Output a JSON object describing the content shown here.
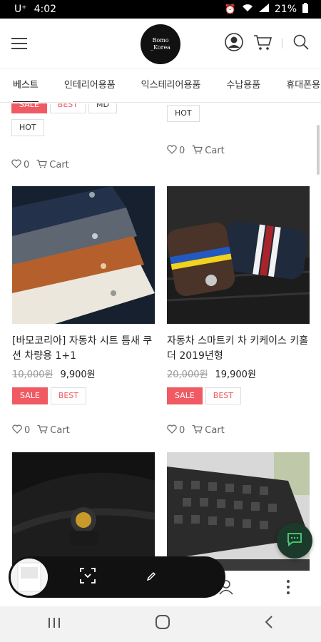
{
  "status_bar": {
    "carrier": "U⁺",
    "time": "4:02",
    "battery": "21%"
  },
  "header": {
    "logo_line1": "Bomo",
    "logo_line2": "_Korea"
  },
  "tabs": [
    {
      "label": "베스트",
      "active": true
    },
    {
      "label": "인테리어용품"
    },
    {
      "label": "익스테리어용품"
    },
    {
      "label": "수납용품"
    },
    {
      "label": "휴대폰용"
    }
  ],
  "partial_row": {
    "left_badges": [
      "SALE",
      "BEST",
      "MD",
      "HOT"
    ],
    "right_badges": [
      "HOT"
    ],
    "left_likes": "0",
    "right_likes": "0",
    "cart_label": "Cart"
  },
  "products": [
    {
      "title": "[바모코리아] 자동차 시트 틈새 쿠션 차량용 1+1",
      "price_old": "10,000원",
      "price_new": "9,900원",
      "badges": [
        "SALE",
        "BEST"
      ],
      "likes": "0",
      "cart_label": "Cart"
    },
    {
      "title": "자동차 스마트키 차 키케이스 키홀더 2019년형",
      "price_old": "20,000원",
      "price_new": "19,900원",
      "badges": [
        "SALE",
        "BEST"
      ],
      "likes": "0",
      "cart_label": "Cart"
    }
  ]
}
